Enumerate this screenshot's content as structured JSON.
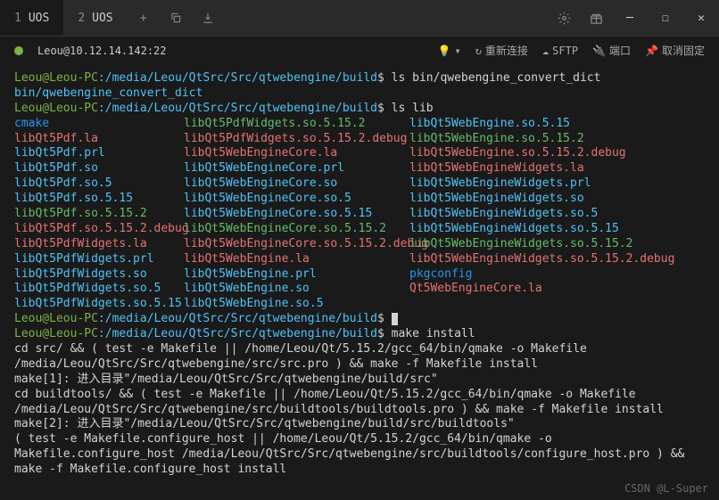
{
  "tabs": [
    {
      "num": "1",
      "name": "UOS"
    },
    {
      "num": "2",
      "name": "UOS"
    }
  ],
  "statusbar": {
    "conn": "Leou@10.12.14.142:22",
    "reconnect": "重新连接",
    "sftp": "SFTP",
    "port": "端口",
    "unpin": "取消固定"
  },
  "prompt": {
    "user": "Leou@Leou-PC",
    "path": "/media/Leou/QtSrc/Src/qtwebengine/build",
    "dollar": "$"
  },
  "lines": {
    "cmd1": "ls bin/qwebengine_convert_dict",
    "out1": "bin/qwebengine_convert_dict",
    "cmd2": "ls lib",
    "cmd3": "make install",
    "make1": "cd src/ && ( test -e Makefile || /home/Leou/Qt/5.15.2/gcc_64/bin/qmake -o Makefile /media/Leou/QtSrc/Src/qtwebengine/src/src.pro ) && make -f Makefile install",
    "make2": "make[1]: 进入目录\"/media/Leou/QtSrc/Src/qtwebengine/build/src\"",
    "make3": "cd buildtools/ && ( test -e Makefile || /home/Leou/Qt/5.15.2/gcc_64/bin/qmake -o Makefile /media/Leou/QtSrc/Src/qtwebengine/src/buildtools/buildtools.pro ) && make -f Makefile install",
    "make4": "make[2]: 进入目录\"/media/Leou/QtSrc/Src/qtwebengine/build/src/buildtools\"",
    "make5": "( test -e Makefile.configure_host || /home/Leou/Qt/5.15.2/gcc_64/bin/qmake -o Makefile.configure_host /media/Leou/QtSrc/Src/qtwebengine/src/buildtools/configure_host.pro ) && make -f Makefile.configure_host install"
  },
  "listing": {
    "c1": [
      {
        "t": "cmake",
        "c": "blue"
      },
      {
        "t": "libQt5Pdf.la",
        "c": "red"
      },
      {
        "t": "libQt5Pdf.prl",
        "c": "cyan"
      },
      {
        "t": "libQt5Pdf.so",
        "c": "cyan"
      },
      {
        "t": "libQt5Pdf.so.5",
        "c": "cyan"
      },
      {
        "t": "libQt5Pdf.so.5.15",
        "c": "cyan"
      },
      {
        "t": "libQt5Pdf.so.5.15.2",
        "c": "green"
      },
      {
        "t": "libQt5Pdf.so.5.15.2.debug",
        "c": "red"
      },
      {
        "t": "libQt5PdfWidgets.la",
        "c": "red"
      },
      {
        "t": "libQt5PdfWidgets.prl",
        "c": "cyan"
      },
      {
        "t": "libQt5PdfWidgets.so",
        "c": "cyan"
      },
      {
        "t": "libQt5PdfWidgets.so.5",
        "c": "cyan"
      },
      {
        "t": "libQt5PdfWidgets.so.5.15",
        "c": "cyan"
      }
    ],
    "c2": [
      {
        "t": "libQt5PdfWidgets.so.5.15.2",
        "c": "green"
      },
      {
        "t": "libQt5PdfWidgets.so.5.15.2.debug",
        "c": "red"
      },
      {
        "t": "libQt5WebEngineCore.la",
        "c": "red"
      },
      {
        "t": "libQt5WebEngineCore.prl",
        "c": "cyan"
      },
      {
        "t": "libQt5WebEngineCore.so",
        "c": "cyan"
      },
      {
        "t": "libQt5WebEngineCore.so.5",
        "c": "cyan"
      },
      {
        "t": "libQt5WebEngineCore.so.5.15",
        "c": "cyan"
      },
      {
        "t": "libQt5WebEngineCore.so.5.15.2",
        "c": "green"
      },
      {
        "t": "libQt5WebEngineCore.so.5.15.2.debug",
        "c": "red"
      },
      {
        "t": "libQt5WebEngine.la",
        "c": "red"
      },
      {
        "t": "libQt5WebEngine.prl",
        "c": "cyan"
      },
      {
        "t": "libQt5WebEngine.so",
        "c": "cyan"
      },
      {
        "t": "libQt5WebEngine.so.5",
        "c": "cyan"
      }
    ],
    "c3": [
      {
        "t": "libQt5WebEngine.so.5.15",
        "c": "cyan"
      },
      {
        "t": "libQt5WebEngine.so.5.15.2",
        "c": "green"
      },
      {
        "t": "libQt5WebEngine.so.5.15.2.debug",
        "c": "red"
      },
      {
        "t": "libQt5WebEngineWidgets.la",
        "c": "red"
      },
      {
        "t": "libQt5WebEngineWidgets.prl",
        "c": "cyan"
      },
      {
        "t": "libQt5WebEngineWidgets.so",
        "c": "cyan"
      },
      {
        "t": "libQt5WebEngineWidgets.so.5",
        "c": "cyan"
      },
      {
        "t": "libQt5WebEngineWidgets.so.5.15",
        "c": "cyan"
      },
      {
        "t": "libQt5WebEngineWidgets.so.5.15.2",
        "c": "green"
      },
      {
        "t": "libQt5WebEngineWidgets.so.5.15.2.debug",
        "c": "red"
      },
      {
        "t": "pkgconfig",
        "c": "blue"
      },
      {
        "t": "Qt5WebEngineCore.la",
        "c": "red"
      }
    ]
  },
  "watermark": "CSDN @L-Super"
}
